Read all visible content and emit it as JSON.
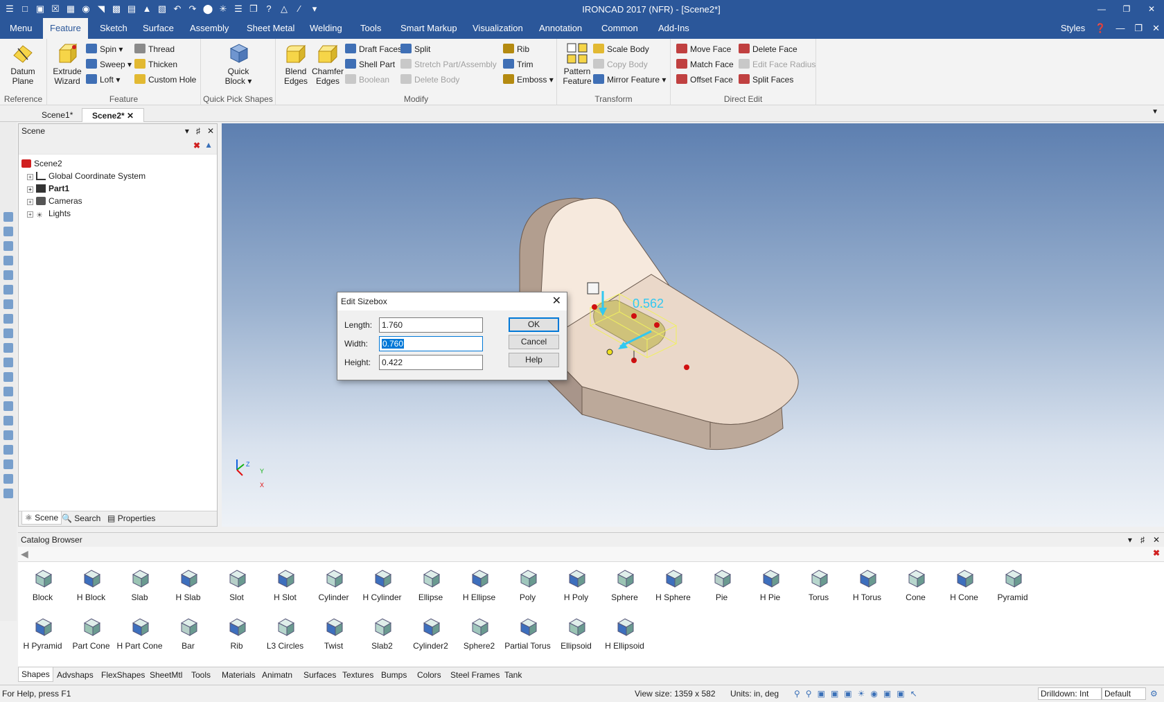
{
  "window": {
    "title": "IRONCAD 2017 (NFR) - [Scene2*]",
    "controls": [
      "minimize",
      "restore",
      "close"
    ]
  },
  "menu": {
    "tabs": [
      "Menu",
      "Feature",
      "Sketch",
      "Surface",
      "Assembly",
      "Sheet Metal",
      "Welding",
      "Tools",
      "Smart Markup",
      "Visualization",
      "Annotation",
      "Common",
      "Add-Ins"
    ],
    "active_tab": "Feature",
    "styles_label": "Styles"
  },
  "ribbon": {
    "reference": {
      "label": "Reference",
      "datum_plane": "Datum Plane"
    },
    "feature": {
      "label": "Feature",
      "extrude_wizard": "Extrude Wizard",
      "spin": "Spin",
      "sweep": "Sweep",
      "loft": "Loft",
      "thread": "Thread",
      "thicken": "Thicken",
      "custom_hole": "Custom Hole"
    },
    "quick_pick": {
      "label": "Quick Pick Shapes",
      "quick_block": "Quick Block"
    },
    "modify": {
      "label": "Modify",
      "blend_edges": "Blend Edges",
      "chamfer_edges": "Chamfer Edges",
      "draft_faces": "Draft Faces",
      "shell_part": "Shell Part",
      "boolean": "Boolean",
      "split": "Split",
      "stretch_part": "Stretch Part/Assembly",
      "delete_body": "Delete Body",
      "rib": "Rib",
      "trim": "Trim",
      "emboss": "Emboss"
    },
    "transform": {
      "label": "Transform",
      "pattern_feature": "Pattern Feature",
      "scale_body": "Scale Body",
      "copy_body": "Copy Body",
      "mirror_feature": "Mirror Feature"
    },
    "direct_edit": {
      "label": "Direct Edit",
      "move_face": "Move Face",
      "match_face": "Match Face",
      "offset_face": "Offset Face",
      "delete_face": "Delete Face",
      "edit_face_radius": "Edit Face Radius",
      "split_faces": "Split Faces"
    }
  },
  "doc_tabs": [
    "Scene1*",
    "Scene2*"
  ],
  "scene_panel": {
    "title": "Scene",
    "tree": [
      {
        "label": "Scene2",
        "bold": false
      },
      {
        "label": "Global Coordinate System",
        "bold": false
      },
      {
        "label": "Part1",
        "bold": true
      },
      {
        "label": "Cameras",
        "bold": false
      },
      {
        "label": "Lights",
        "bold": false
      }
    ],
    "bottom_tabs": [
      "Scene",
      "Search",
      "Properties"
    ]
  },
  "viewport": {
    "dimension_label": "0.562",
    "axis": {
      "z": "Z",
      "y": "Y",
      "x": "X"
    }
  },
  "dialog": {
    "title": "Edit Sizebox",
    "length_label": "Length:",
    "length_value": "1.760",
    "width_label": "Width:",
    "width_value": "0.760",
    "height_label": "Height:",
    "height_value": "0.422",
    "ok": "OK",
    "cancel": "Cancel",
    "help": "Help"
  },
  "catalog": {
    "title": "Catalog Browser",
    "row1": [
      "Block",
      "H Block",
      "Slab",
      "H Slab",
      "Slot",
      "H Slot",
      "Cylinder",
      "H Cylinder",
      "Ellipse",
      "H Ellipse",
      "Poly",
      "H Poly",
      "Sphere",
      "H Sphere",
      "Pie",
      "H Pie",
      "Torus",
      "H Torus",
      "Cone",
      "H Cone",
      "Pyramid"
    ],
    "row2": [
      "H Pyramid",
      "Part Cone",
      "H Part Cone",
      "Bar",
      "Rib",
      "L3 Circles",
      "Twist",
      "Slab2",
      "Cylinder2",
      "Sphere2",
      "Partial Torus",
      "Ellipsoid",
      "H Ellipsoid"
    ],
    "tabs": [
      "Shapes",
      "Advshaps",
      "FlexShapes",
      "SheetMtl",
      "Tools",
      "Materials",
      "Animatn",
      "Surfaces",
      "Textures",
      "Bumps",
      "Colors",
      "Steel Frames",
      "Tank"
    ]
  },
  "status": {
    "help": "For Help, press F1",
    "view_size": "View size: 1359 x  582",
    "units": "Units: in, deg",
    "drilldown": "Drilldown: Int",
    "default": "Default"
  },
  "colors": {
    "accent": "#2b579a",
    "part_face": "#f5e7dc",
    "part_side": "#bca99a",
    "sizebox": "#f0f060",
    "handle": "#d01010",
    "dimension": "#32c8f0"
  }
}
